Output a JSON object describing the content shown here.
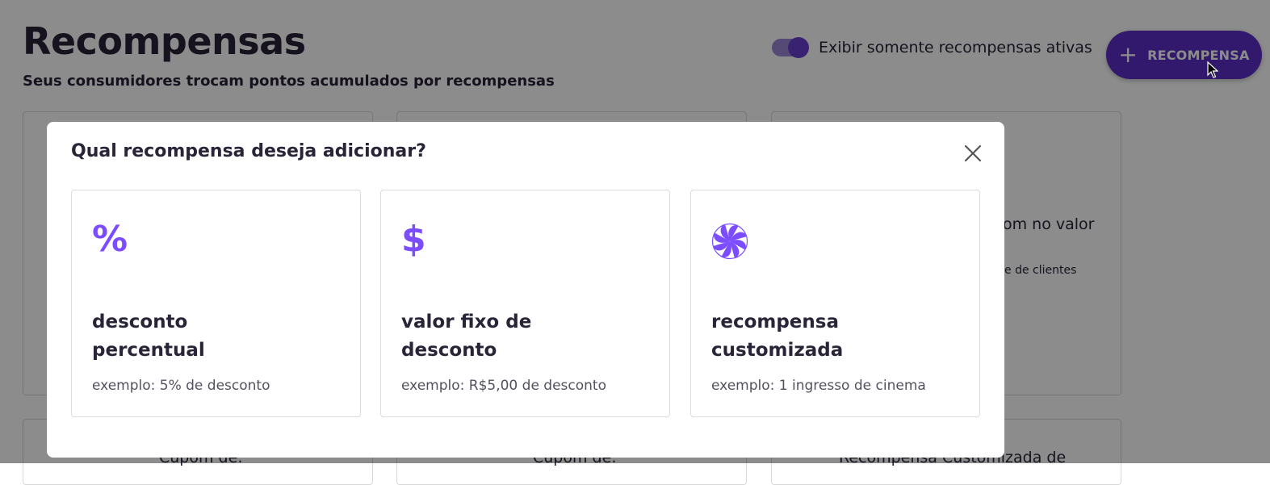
{
  "page": {
    "title": "Recompensas",
    "subtitle": "Seus consumidores trocam pontos acumulados por recompensas",
    "toggle_label": "Exibir somente recompensas ativas",
    "toggle_on": true,
    "add_button_label": "RECOMPENSA",
    "bg_card_fragments": {
      "card3_line1": "om no valor",
      "card3_line2": "e de clientes",
      "row2_card1": "Cupom de:",
      "row2_card2": "Cupom de:",
      "row2_card3": "Recompensa Customizada de"
    }
  },
  "modal": {
    "title": "Qual recompensa deseja adicionar?",
    "close_icon": "close-icon",
    "options": [
      {
        "icon": "percent-icon",
        "icon_glyph": "%",
        "title": "desconto percentual",
        "example": "exemplo: 5% de desconto"
      },
      {
        "icon": "dollar-icon",
        "icon_glyph": "$",
        "title": "valor fixo de desconto",
        "example": "exemplo: R$5,00 de desconto"
      },
      {
        "icon": "swirl-icon",
        "icon_glyph": "",
        "title": "recompensa customizada",
        "example": "exemplo: 1 ingresso de cinema"
      }
    ]
  },
  "colors": {
    "accent": "#7c4dff",
    "primary_button": "#5b2ec6",
    "text": "#2a2438"
  }
}
